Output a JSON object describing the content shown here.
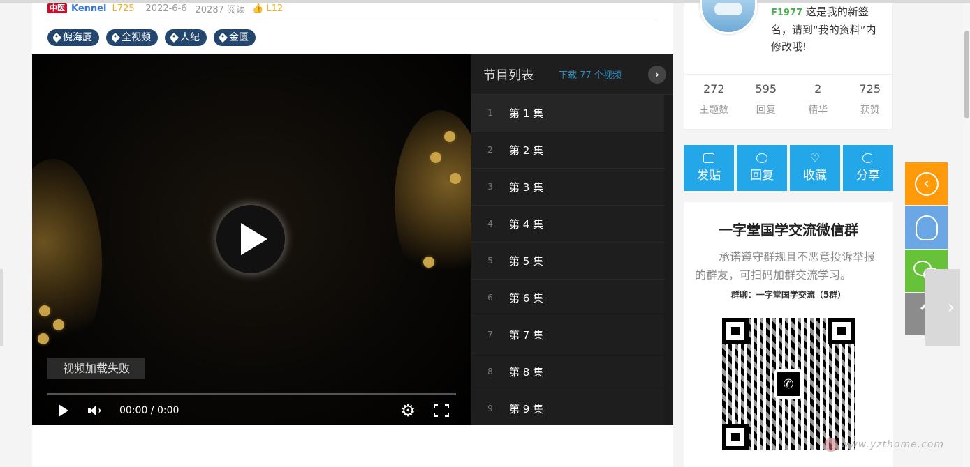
{
  "post_meta": {
    "category_badge": "中医",
    "author": "Kennel",
    "author_level": "L725",
    "date": "2022-6-6",
    "views": "20287 阅读",
    "likes_level": "L12"
  },
  "tags": [
    {
      "label": "倪海厦"
    },
    {
      "label": "全视频"
    },
    {
      "label": "人纪"
    },
    {
      "label": "金匮"
    }
  ],
  "player": {
    "error_message": "视频加载失败",
    "time": "00:00 / 0:00"
  },
  "playlist": {
    "title": "节目列表",
    "download": "下载 77 个视频",
    "items": [
      {
        "num": "1",
        "name": "第 1 集"
      },
      {
        "num": "2",
        "name": "第 2 集"
      },
      {
        "num": "3",
        "name": "第 3 集"
      },
      {
        "num": "4",
        "name": "第 4 集"
      },
      {
        "num": "5",
        "name": "第 5 集"
      },
      {
        "num": "6",
        "name": "第 6 集"
      },
      {
        "num": "7",
        "name": "第 7 集"
      },
      {
        "num": "8",
        "name": "第 8 集"
      },
      {
        "num": "9",
        "name": "第 9 集"
      }
    ]
  },
  "profile": {
    "uid": "F1977",
    "signature": "这是我的新签名，请到“我的资料”内修改哦!",
    "stats": [
      {
        "value": "272",
        "label": "主题数"
      },
      {
        "value": "595",
        "label": "回复"
      },
      {
        "value": "2",
        "label": "精华"
      },
      {
        "value": "725",
        "label": "获赞"
      }
    ]
  },
  "actions": [
    {
      "label": "发贴",
      "icon": "edit-icon"
    },
    {
      "label": "回复",
      "icon": "chat-icon"
    },
    {
      "label": "收藏",
      "icon": "heart-icon"
    },
    {
      "label": "分享",
      "icon": "share-icon"
    }
  ],
  "wechat_group": {
    "title": "一字堂国学交流微信群",
    "description": "承诺遵守群规且不恶意投诉举报的群友，可扫码加群交流学习。",
    "group_name": "群聊：一字堂国学交流（5群）"
  },
  "watermark": "www.yzthome.com",
  "colors": {
    "accent_blue": "#24a7e8",
    "tag_navy": "#22466e",
    "back_orange": "#ff9a0a",
    "qq_blue": "#6aa7e4",
    "wechat_green": "#67c23a",
    "top_gray": "#8c8c8c"
  }
}
